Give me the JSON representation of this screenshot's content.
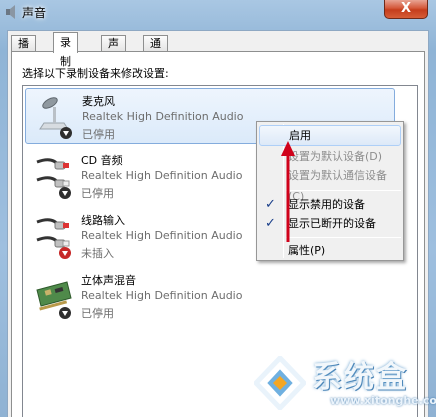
{
  "window": {
    "title": "声音",
    "close_label": "X"
  },
  "tabs": [
    {
      "label": "播放",
      "active": false
    },
    {
      "label": "录制",
      "active": true
    },
    {
      "label": "声音",
      "active": false
    },
    {
      "label": "通信",
      "active": false
    }
  ],
  "instruction": "选择以下录制设备来修改设置:",
  "devices": [
    {
      "name": "麦克风",
      "driver": "Realtek High Definition Audio",
      "status": "已停用",
      "icon": "microphone-icon",
      "selected": true
    },
    {
      "name": "CD 音频",
      "driver": "Realtek High Definition Audio",
      "status": "已停用",
      "icon": "rca-cable-icon",
      "selected": false
    },
    {
      "name": "线路输入",
      "driver": "Realtek High Definition Audio",
      "status": "未插入",
      "icon": "rca-cable-icon",
      "selected": false
    },
    {
      "name": "立体声混音",
      "driver": "Realtek High Definition Audio",
      "status": "已停用",
      "icon": "sound-card-icon",
      "selected": false
    }
  ],
  "context_menu": {
    "items": [
      {
        "label": "启用",
        "enabled": true,
        "checked": false,
        "highlighted": true
      },
      {
        "label": "设置为默认设备(D)",
        "enabled": false,
        "checked": false
      },
      {
        "label": "设置为默认通信设备(C)",
        "enabled": false,
        "checked": false
      },
      {
        "label": "显示禁用的设备",
        "enabled": true,
        "checked": true
      },
      {
        "label": "显示已断开的设备",
        "enabled": true,
        "checked": true
      },
      {
        "label": "属性(P)",
        "enabled": true,
        "checked": false
      }
    ]
  },
  "watermark": {
    "brand": "系统盒",
    "url": "www.xitonghe.com"
  },
  "colors": {
    "annotation_arrow": "#d0021b",
    "selection": "#dbeafa",
    "window_frame": "#9ebfdf"
  }
}
